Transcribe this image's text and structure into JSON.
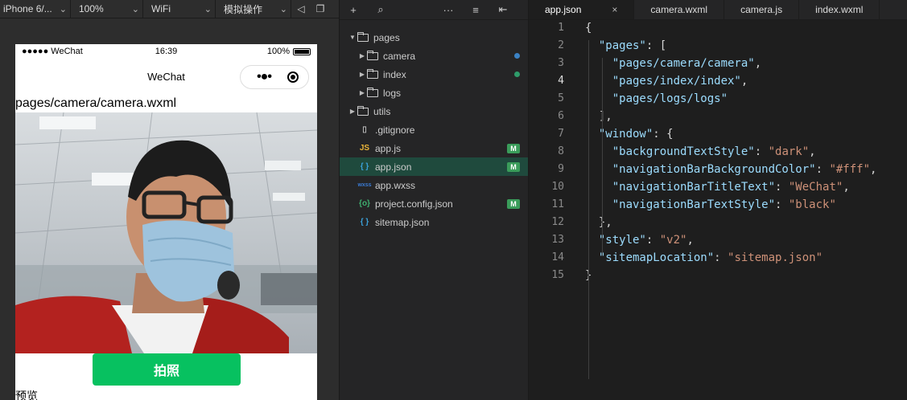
{
  "simulator": {
    "device": "iPhone 6/...",
    "zoom": "100%",
    "network": "WiFi",
    "operation": "模拟操作",
    "status_bar": {
      "carrier": "●●●●● WeChat",
      "time": "16:39",
      "battery": "100%"
    },
    "nav_title": "WeChat",
    "page_path": "pages/camera/camera.wxml",
    "shoot_button": "拍照",
    "preview_label": "预览"
  },
  "explorer": {
    "rows": [
      {
        "name": "pages",
        "type": "folder",
        "expanded": true
      },
      {
        "name": "camera",
        "type": "folder",
        "status": "modified-dot",
        "status_color": "#3b82c4"
      },
      {
        "name": "index",
        "type": "folder",
        "status": "modified-dot",
        "status_color": "#2e9c6a"
      },
      {
        "name": "logs",
        "type": "folder"
      },
      {
        "name": "utils",
        "type": "folder"
      },
      {
        "name": ".gitignore",
        "type": "file"
      },
      {
        "name": "app.js",
        "type": "js",
        "icon_text": "JS",
        "badge": "M"
      },
      {
        "name": "app.json",
        "type": "json",
        "icon_text": "{ }",
        "badge": "M",
        "active": true
      },
      {
        "name": "app.wxss",
        "type": "wxss",
        "icon_text": "wxss"
      },
      {
        "name": "project.config.json",
        "type": "config",
        "icon_text": "{o}",
        "badge": "M"
      },
      {
        "name": "sitemap.json",
        "type": "json",
        "icon_text": "{ }"
      }
    ]
  },
  "editor": {
    "tabs": [
      {
        "label": "app.json",
        "active": true,
        "close": "×"
      },
      {
        "label": "camera.wxml"
      },
      {
        "label": "camera.js"
      },
      {
        "label": "index.wxml"
      }
    ],
    "current_line": 4,
    "lines": [
      "{",
      "  \"pages\": [",
      "    \"pages/camera/camera\",",
      "    \"pages/index/index\",",
      "    \"pages/logs/logs\"",
      "  ],",
      "  \"window\": {",
      "    \"backgroundTextStyle\": \"dark\",",
      "    \"navigationBarBackgroundColor\": \"#fff\",",
      "    \"navigationBarTitleText\": \"WeChat\",",
      "    \"navigationBarTextStyle\": \"black\"",
      "  },",
      "  \"style\": \"v2\",",
      "  \"sitemapLocation\": \"sitemap.json\"",
      "}"
    ]
  },
  "colors": {
    "accent_green": "#07c160",
    "badge_green": "#3a9c5a",
    "json_key": "#9cdcfe",
    "json_string": "#ce9178"
  }
}
